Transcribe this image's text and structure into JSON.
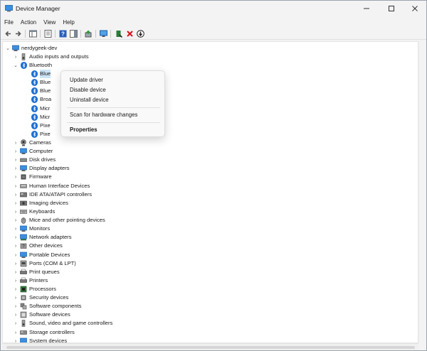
{
  "window": {
    "title": "Device Manager"
  },
  "menubar": {
    "items": [
      "File",
      "Action",
      "View",
      "Help"
    ]
  },
  "tree": {
    "root": "nerdygeek-dev",
    "categories": [
      {
        "label": "Audio inputs and outputs",
        "icon": "speaker-icon",
        "expanded": false
      },
      {
        "label": "Bluetooth",
        "icon": "bluetooth-icon",
        "expanded": true
      },
      {
        "label": "Cameras",
        "icon": "camera-icon",
        "expanded": false
      },
      {
        "label": "Computer",
        "icon": "monitor-icon",
        "expanded": false
      },
      {
        "label": "Disk drives",
        "icon": "disk-icon",
        "expanded": false
      },
      {
        "label": "Display adapters",
        "icon": "display-adapter-icon",
        "expanded": false
      },
      {
        "label": "Firmware",
        "icon": "chip-icon",
        "expanded": false
      },
      {
        "label": "Human Interface Devices",
        "icon": "hid-icon",
        "expanded": false
      },
      {
        "label": "IDE ATA/ATAPI controllers",
        "icon": "controller-icon",
        "expanded": false
      },
      {
        "label": "Imaging devices",
        "icon": "imaging-icon",
        "expanded": false
      },
      {
        "label": "Keyboards",
        "icon": "keyboard-icon",
        "expanded": false
      },
      {
        "label": "Mice and other pointing devices",
        "icon": "mouse-icon",
        "expanded": false
      },
      {
        "label": "Monitors",
        "icon": "monitor-icon",
        "expanded": false
      },
      {
        "label": "Network adapters",
        "icon": "network-icon",
        "expanded": false
      },
      {
        "label": "Other devices",
        "icon": "other-device-icon",
        "expanded": false
      },
      {
        "label": "Portable Devices",
        "icon": "portable-icon",
        "expanded": false
      },
      {
        "label": "Ports (COM & LPT)",
        "icon": "port-icon",
        "expanded": false
      },
      {
        "label": "Print queues",
        "icon": "printer-icon",
        "expanded": false
      },
      {
        "label": "Printers",
        "icon": "printer-icon",
        "expanded": false
      },
      {
        "label": "Processors",
        "icon": "processor-icon",
        "expanded": false
      },
      {
        "label": "Security devices",
        "icon": "security-icon",
        "expanded": false
      },
      {
        "label": "Software components",
        "icon": "software-component-icon",
        "expanded": false
      },
      {
        "label": "Software devices",
        "icon": "software-device-icon",
        "expanded": false
      },
      {
        "label": "Sound, video and game controllers",
        "icon": "sound-icon",
        "expanded": false
      },
      {
        "label": "Storage controllers",
        "icon": "storage-icon",
        "expanded": false
      },
      {
        "label": "System devices",
        "icon": "system-icon",
        "expanded": false
      }
    ],
    "bluetooth_children": [
      "Blue",
      "Blue",
      "Blue",
      "Broa",
      "Micr",
      "Micr",
      "Pixe",
      "Pixe"
    ]
  },
  "context_menu": {
    "items": [
      "Update driver",
      "Disable device",
      "Uninstall device",
      "Scan for hardware changes",
      "Properties"
    ]
  },
  "colors": {
    "accent": "#1f6fd1",
    "selection": "#cce4f7"
  }
}
